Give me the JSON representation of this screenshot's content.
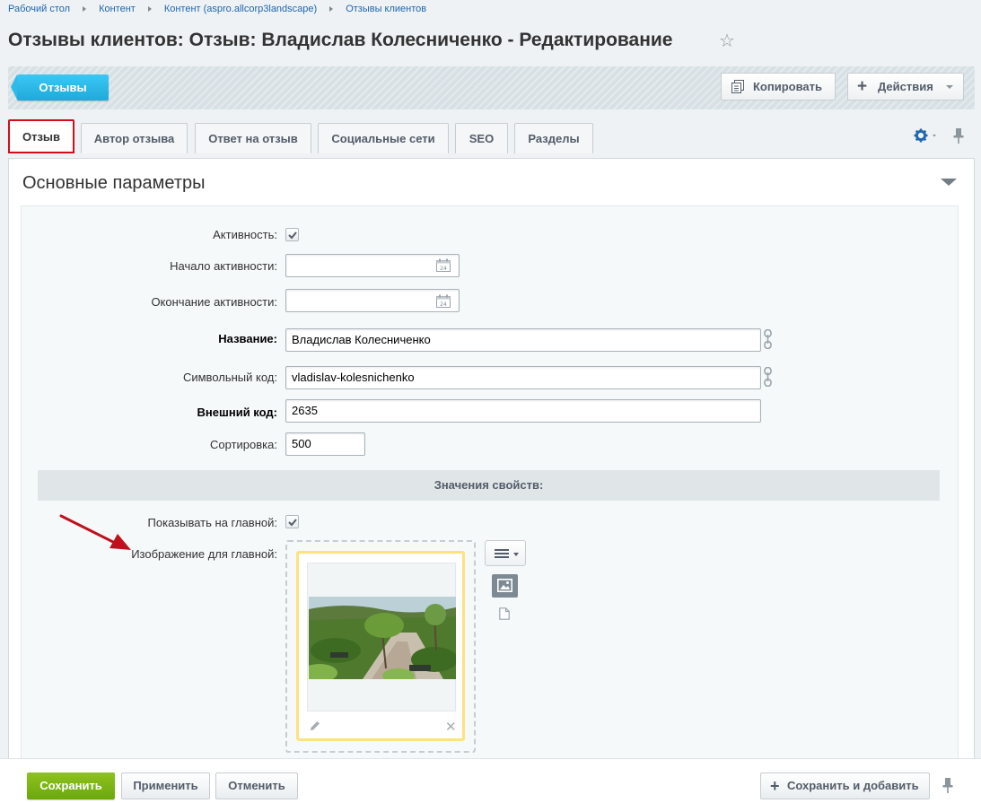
{
  "breadcrumb": [
    "Рабочий стол",
    "Контент",
    "Контент (aspro.allcorp3landscape)",
    "Отзывы клиентов"
  ],
  "page_title": "Отзывы клиентов: Отзыв: Владислав Колесниченко - Редактирование",
  "toolbar": {
    "back_label": "Отзывы",
    "copy_label": "Копировать",
    "actions_label": "Действия"
  },
  "tabs": [
    "Отзыв",
    "Автор отзыва",
    "Ответ на отзыв",
    "Социальные сети",
    "SEO",
    "Разделы"
  ],
  "section_title": "Основные параметры",
  "fields": {
    "active_label": "Активность:",
    "active_from_label": "Начало активности:",
    "active_from_value": "",
    "active_to_label": "Окончание активности:",
    "active_to_value": "",
    "name_label": "Название:",
    "name_value": "Владислав Колесниченко",
    "code_label": "Символьный код:",
    "code_value": "vladislav-kolesnichenko",
    "xml_id_label": "Внешний код:",
    "xml_id_value": "2635",
    "sort_label": "Сортировка:",
    "sort_value": "500"
  },
  "calendar_day": "24",
  "properties": {
    "header": "Значения свойств:",
    "show_main_label": "Показывать на главной:",
    "image_label": "Изображение для главной:"
  },
  "footer": {
    "save_label": "Сохранить",
    "apply_label": "Применить",
    "cancel_label": "Отменить",
    "save_add_label": "Сохранить и добавить"
  },
  "colors": {
    "active_tab_outline": "#d30c1c",
    "back_button": "#2fbbe9",
    "save_button": "#7bb713",
    "annotation_arrow": "#c0101e",
    "selected_file_border": "#ffe17d"
  }
}
